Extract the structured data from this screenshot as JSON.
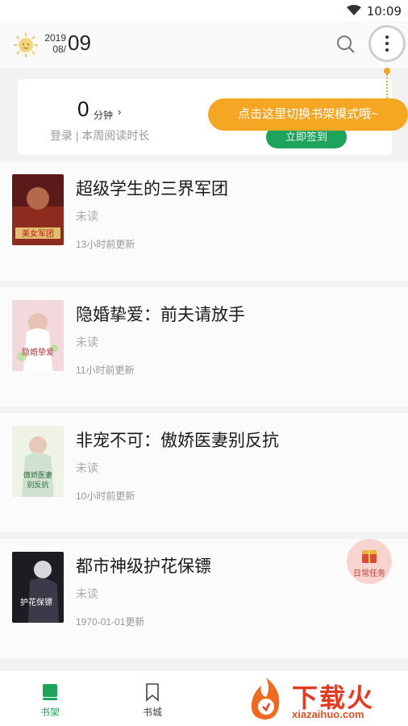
{
  "status_bar": {
    "time": "10:09"
  },
  "header": {
    "year": "2019",
    "month": "08/",
    "day": "09"
  },
  "reading_stats": {
    "minutes": "0",
    "unit": "分钟",
    "arrow": "›",
    "subtitle": "登录 | 本周阅读时长",
    "signin_label": "立即签到"
  },
  "tooltip": {
    "text": "点击这里切换书架模式哦~"
  },
  "books": [
    {
      "title": "超级学生的三界军团",
      "status": "未读",
      "updated": "13小时前更新"
    },
    {
      "title": "隐婚挚爱：前夫请放手",
      "status": "未读",
      "updated": "11小时前更新"
    },
    {
      "title": "非宠不可：傲娇医妻别反抗",
      "status": "未读",
      "updated": "10小时前更新"
    },
    {
      "title": "都市神级护花保镖",
      "status": "未读",
      "updated": "1970-01-01更新"
    }
  ],
  "daily_task": {
    "label": "日常任务"
  },
  "bottom_nav": {
    "tabs": [
      {
        "label": "书架",
        "active": true
      },
      {
        "label": "书城",
        "active": false
      }
    ]
  },
  "watermark": {
    "text": "下载火",
    "url": "xiazaihuo.com"
  },
  "colors": {
    "accent": "#1ea35a",
    "tooltip": "#f5a623",
    "watermark": "#e23b22"
  }
}
